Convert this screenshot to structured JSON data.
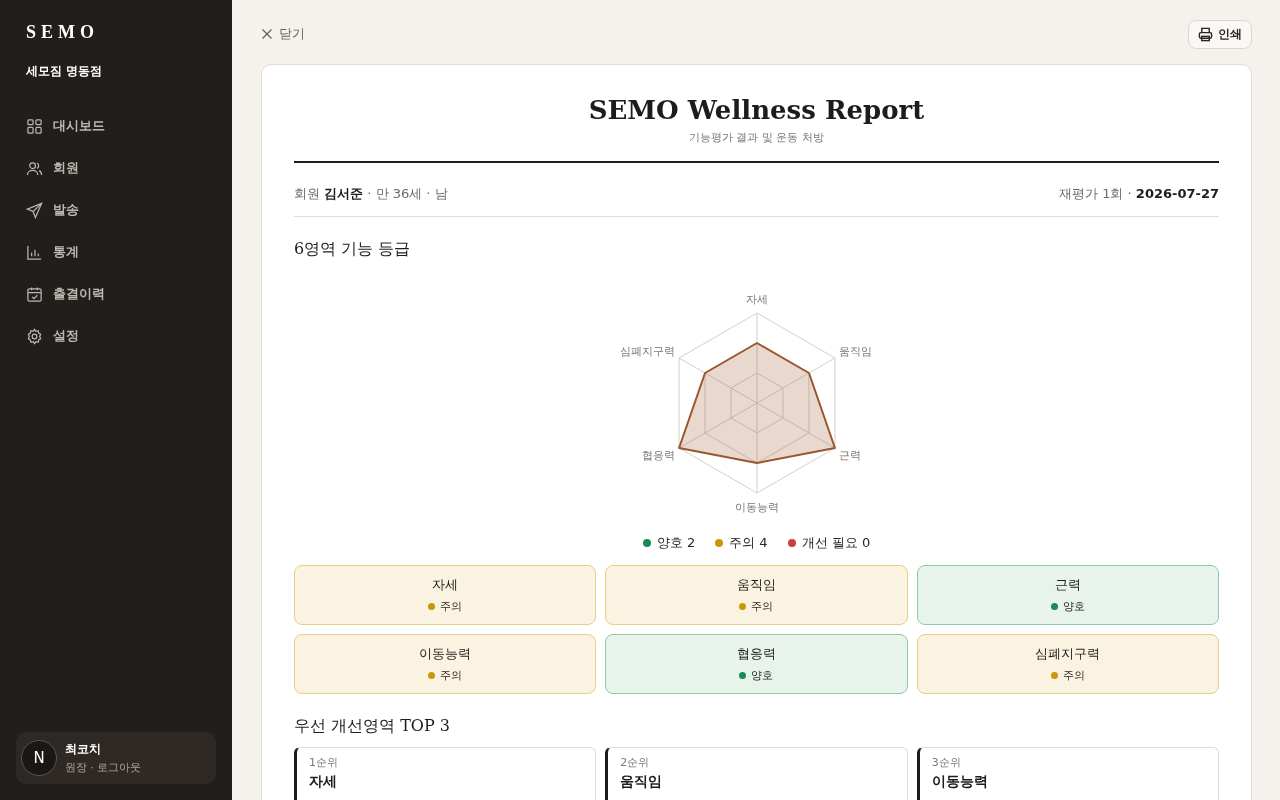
{
  "sidebar": {
    "logo": "SEMO",
    "branch": "세모짐 명동점",
    "items": [
      {
        "label": "대시보드",
        "selected": false
      },
      {
        "label": "회원",
        "selected": false
      },
      {
        "label": "발송",
        "selected": false
      },
      {
        "label": "통계",
        "selected": false
      },
      {
        "label": "출결이력",
        "selected": false
      },
      {
        "label": "설정",
        "selected": false
      }
    ],
    "user": {
      "avatar": "N",
      "name": "최코치",
      "role": "원장 · 로그아웃"
    }
  },
  "toolbar": {
    "close": "닫기",
    "print": "인쇄"
  },
  "report": {
    "title": "SEMO Wellness Report",
    "subtitle": "기능평가 결과 및 운동 처방",
    "member": "회원 **김서준** · 만 36세 · 남",
    "session": "재평가 1회 · **2026-07-27**",
    "grades_title": "6영역 기능 등급",
    "legend": [
      {
        "label": "양호",
        "count": "2",
        "color": "#1a8a55"
      },
      {
        "label": "주의",
        "count": "4",
        "color": "#c9980a"
      },
      {
        "label": "개선 필요",
        "count": "0",
        "color": "#c94040"
      }
    ],
    "areas": [
      {
        "name": "자세",
        "grade": "주의",
        "kind": "caution"
      },
      {
        "name": "움직임",
        "grade": "주의",
        "kind": "caution"
      },
      {
        "name": "근력",
        "grade": "양호",
        "kind": "good"
      },
      {
        "name": "이동능력",
        "grade": "주의",
        "kind": "caution"
      },
      {
        "name": "협응력",
        "grade": "양호",
        "kind": "good"
      },
      {
        "name": "심폐지구력",
        "grade": "주의",
        "kind": "caution"
      }
    ],
    "radar": {
      "axes": [
        {
          "label": "자세",
          "kind": "caution"
        },
        {
          "label": "움직임",
          "kind": "caution"
        },
        {
          "label": "근력",
          "kind": "good"
        },
        {
          "label": "이동능력",
          "kind": "caution"
        },
        {
          "label": "협응력",
          "kind": "good"
        },
        {
          "label": "심폐지구력",
          "kind": "caution"
        }
      ]
    },
    "top_title": "우선 개선영역 TOP 3",
    "top": [
      {
        "rank": "1순위",
        "name": "자세"
      },
      {
        "rank": "2순위",
        "name": "움직임"
      },
      {
        "rank": "3순위",
        "name": "이동능력"
      }
    ]
  }
}
